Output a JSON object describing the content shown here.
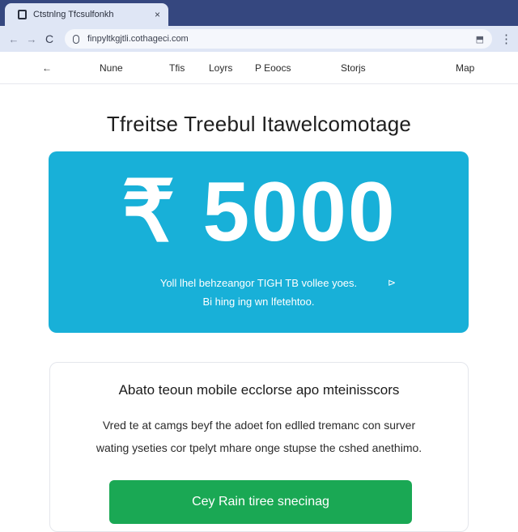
{
  "browser": {
    "tab_title": "Ctstnlng Tfcsulfonkh",
    "tab_close": "×",
    "url": "finpyltkgjtli.cothageci.com",
    "back_icon": "←",
    "forward_icon": "→",
    "reload_icon": "C",
    "extension_icon": "⬒",
    "menu_icon": "⋮"
  },
  "nav": {
    "back": "←",
    "items": [
      "Nune",
      "Tfis",
      "Loyrs",
      "P Eoocs",
      "Storjs",
      "Map"
    ]
  },
  "headline": "Tfreitse Treebul Itawelcomotage",
  "banner": {
    "currency": "₹",
    "amount": "5000",
    "line1": "Yoll lhel behzeangor TIGH TB vollee yoes.",
    "line2": "Bi hing ing wn lfetehtoo.",
    "cursor": "⊳",
    "color": "#18b0d8"
  },
  "card": {
    "title": "Abato teoun mobile ecclorse apo mteinisscors",
    "line1": "Vred te at camgs beyf the adoet fon edlled tremanc con surver",
    "line2": "wating yseties cor tpelyt mhare onge stupse the cshed anethimo.",
    "button": "Cey Rain tiree snecinag",
    "button_color": "#1aa854"
  }
}
